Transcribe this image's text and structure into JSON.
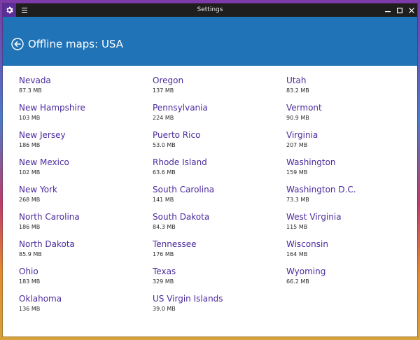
{
  "window": {
    "title": "Settings"
  },
  "header": {
    "title": "Offline maps: USA"
  },
  "colors": {
    "accent": "#1f73b6",
    "link": "#4b2a9c",
    "titlebar": "#1e1e1e"
  },
  "columns": [
    [
      {
        "name": "Nevada",
        "size": "87.3 MB"
      },
      {
        "name": "New Hampshire",
        "size": "103 MB"
      },
      {
        "name": "New Jersey",
        "size": "186 MB"
      },
      {
        "name": "New Mexico",
        "size": "102 MB"
      },
      {
        "name": "New York",
        "size": "268 MB"
      },
      {
        "name": "North Carolina",
        "size": "186 MB"
      },
      {
        "name": "North Dakota",
        "size": "85.9 MB"
      },
      {
        "name": "Ohio",
        "size": "183 MB"
      },
      {
        "name": "Oklahoma",
        "size": "136 MB"
      }
    ],
    [
      {
        "name": "Oregon",
        "size": "137 MB"
      },
      {
        "name": "Pennsylvania",
        "size": "224 MB"
      },
      {
        "name": "Puerto Rico",
        "size": "53.0 MB"
      },
      {
        "name": "Rhode Island",
        "size": "63.6 MB"
      },
      {
        "name": "South Carolina",
        "size": "141 MB"
      },
      {
        "name": "South Dakota",
        "size": "84.3 MB"
      },
      {
        "name": "Tennessee",
        "size": "176 MB"
      },
      {
        "name": "Texas",
        "size": "329 MB"
      },
      {
        "name": "US Virgin Islands",
        "size": "39.0 MB"
      }
    ],
    [
      {
        "name": "Utah",
        "size": "83.2 MB"
      },
      {
        "name": "Vermont",
        "size": "90.9 MB"
      },
      {
        "name": "Virginia",
        "size": "207 MB"
      },
      {
        "name": "Washington",
        "size": "159 MB"
      },
      {
        "name": "Washington D.C.",
        "size": "73.3 MB"
      },
      {
        "name": "West Virginia",
        "size": "115 MB"
      },
      {
        "name": "Wisconsin",
        "size": "164 MB"
      },
      {
        "name": "Wyoming",
        "size": "66.2 MB"
      }
    ]
  ]
}
